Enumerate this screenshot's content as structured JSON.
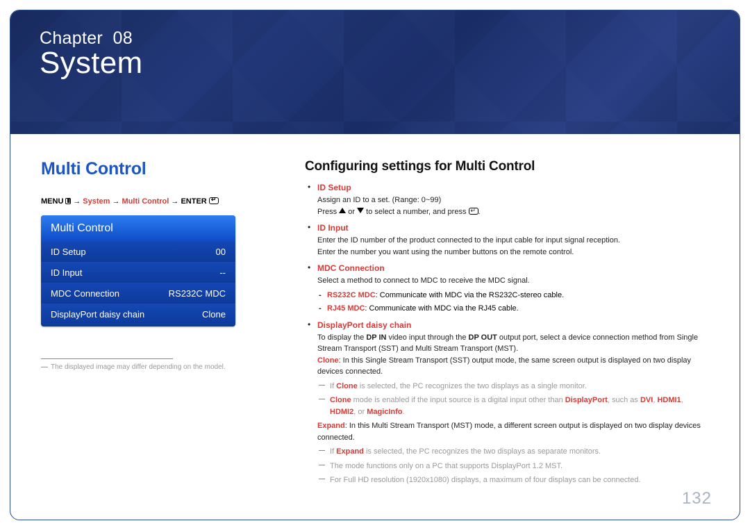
{
  "banner": {
    "chapter_prefix": "Chapter",
    "chapter_number": "08",
    "title": "System"
  },
  "left": {
    "section_title": "Multi Control",
    "breadcrumb": {
      "menu": "MENU",
      "arrow": "→",
      "system": "System",
      "multi": "Multi Control",
      "enter": "ENTER"
    },
    "osd": {
      "title": "Multi Control",
      "rows": [
        {
          "label": "ID Setup",
          "value": "00"
        },
        {
          "label": "ID Input",
          "value": "--"
        },
        {
          "label": "MDC Connection",
          "value": "RS232C MDC"
        },
        {
          "label": "DisplayPort daisy chain",
          "value": "Clone"
        }
      ]
    },
    "footnote": "The displayed image may differ depending on the model."
  },
  "right": {
    "title": "Configuring settings for Multi Control",
    "items": {
      "id_setup": {
        "head": "ID Setup",
        "line1": "Assign an ID to a set. (Range: 0~99)",
        "line2_pre": "Press ",
        "line2_mid": " or ",
        "line2_post": " to select a number, and press ",
        "line2_end": "."
      },
      "id_input": {
        "head": "ID Input",
        "line1": "Enter the ID number of the product connected to the input cable for input signal reception.",
        "line2": "Enter the number you want using the number buttons on the remote control."
      },
      "mdc": {
        "head": "MDC Connection",
        "line1": "Select a method to connect to MDC to receive the MDC signal.",
        "sub1_hl": "RS232C MDC",
        "sub1_rest": ": Communicate with MDC via the RS232C-stereo cable.",
        "sub2_hl": "RJ45 MDC",
        "sub2_rest": ": Communicate with MDC via the RJ45 cable."
      },
      "dp": {
        "head": "DisplayPort daisy chain",
        "line1_pre": "To display the ",
        "line1_b1": "DP IN",
        "line1_mid": " video input through the ",
        "line1_b2": "DP OUT",
        "line1_post": " output port, select a device connection method from Single Stream Transport (SST) and Multi Stream Transport (MST).",
        "clone_hl": "Clone",
        "clone_rest": ": In this Single Stream Transport (SST) output mode, the same screen output is displayed on two display devices connected.",
        "note1_pre": "If ",
        "note1_hl": "Clone",
        "note1_post": " is selected, the PC recognizes the two displays as a single monitor.",
        "note2_hl1": "Clone",
        "note2_mid1": " mode is enabled if the input source is a digital input other than ",
        "note2_hl2": "DisplayPort",
        "note2_mid2": ", such as ",
        "note2_hl3": "DVI",
        "note2_c1": ", ",
        "note2_hl4": "HDMI1",
        "note2_c2": ", ",
        "note2_hl5": "HDMI2",
        "note2_mid3": ", or ",
        "note2_hl6": "MagicInfo",
        "note2_end": ".",
        "expand_hl": "Expand",
        "expand_rest": ": In this Multi Stream Transport (MST) mode, a different screen output is displayed on two display devices connected.",
        "note3_pre": "If ",
        "note3_hl": "Expand",
        "note3_post": " is selected, the PC recognizes the two displays as separate monitors.",
        "note4": "The mode functions only on a PC that supports DisplayPort 1.2 MST.",
        "note5": "For Full HD resolution (1920x1080) displays, a maximum of four displays can be connected."
      }
    }
  },
  "page_number": "132"
}
